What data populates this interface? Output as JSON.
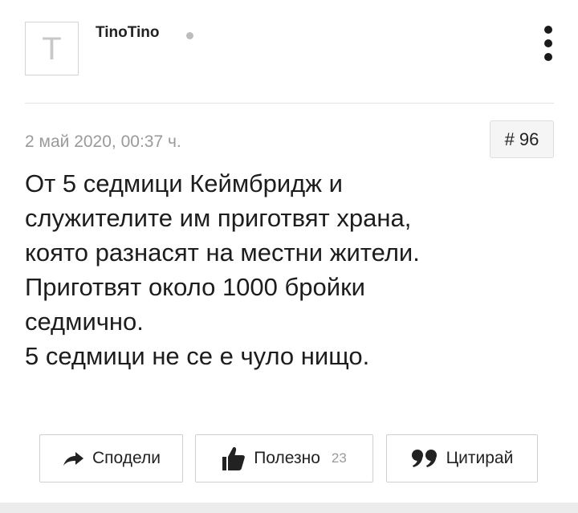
{
  "post": {
    "avatar_letter": "T",
    "username": "TinoTino",
    "timestamp": "2 май 2020, 00:37 ч.",
    "post_number": "# 96",
    "body_lines": [
      "От 5 седмици Кеймбридж и",
      "служителите им приготвят храна,",
      "която разнасят на местни жители.",
      "Приготвят около 1000 бройки",
      "седмично.",
      "5 седмици не се е чуло нищо."
    ]
  },
  "actions": {
    "share_label": "Сподели",
    "share_icon": "share-arrow-icon",
    "useful_label": "Полезно",
    "useful_count": "23",
    "useful_icon": "thumbs-up-icon",
    "quote_label": "Цитирай",
    "quote_icon": "quote-icon"
  },
  "menu_icon": "kebab-menu-icon",
  "colors": {
    "online_dot": "#bdbdbd",
    "muted_text": "#9a9a9a",
    "border": "#cfcfcf",
    "post_number_bg": "#f5f5f5"
  }
}
